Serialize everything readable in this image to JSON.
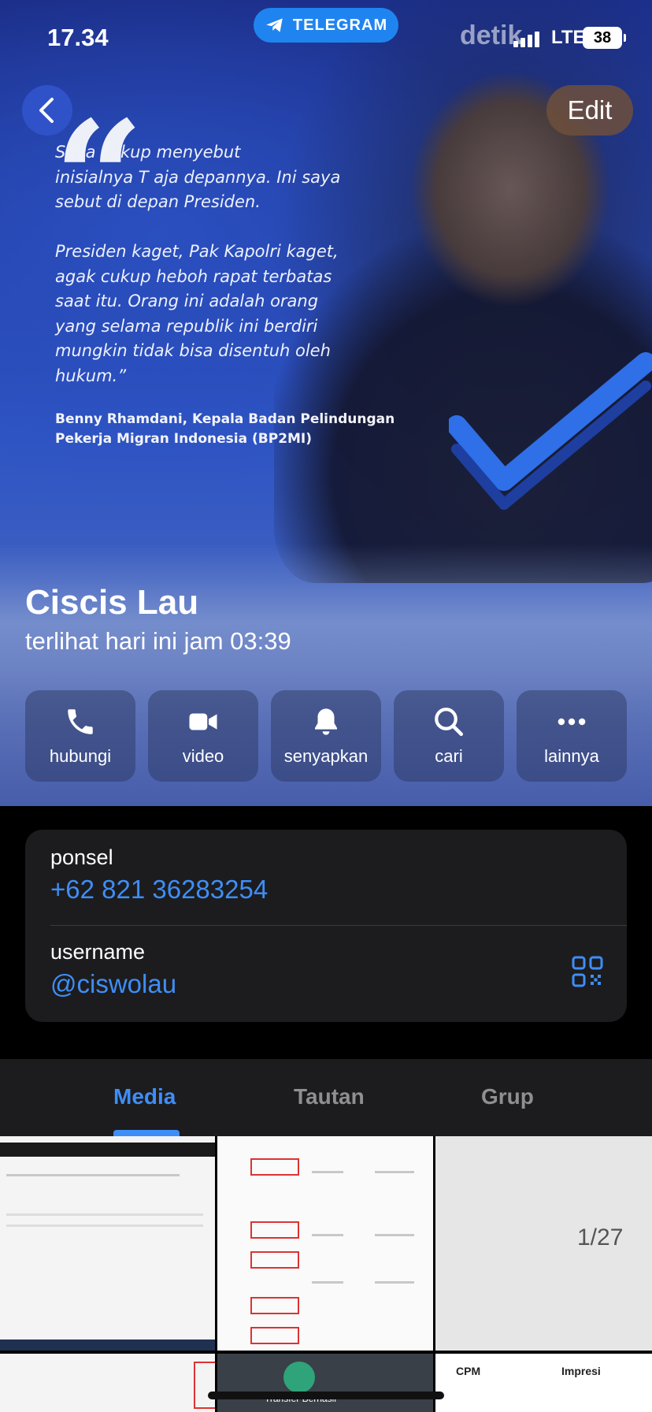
{
  "status_bar": {
    "time": "17.34",
    "watermark": "detik",
    "network": "LTE",
    "battery": "38"
  },
  "telegram_pill": {
    "label": "TELEGRAM"
  },
  "header": {
    "edit_label": "Edit"
  },
  "profile_photo": {
    "quote": "Saya cukup menyebut\ninisialnya T aja depannya. Ini saya\nsebut di depan Presiden.\n\nPresiden kaget, Pak Kapolri kaget,\nagak cukup heboh rapat terbatas\nsaat itu. Orang ini adalah orang\nyang selama republik ini berdiri\nmungkin tidak bisa disentuh oleh\nhukum.”",
    "author": "Benny Rhamdani, Kepala Badan Pelindungan Pekerja Migran Indonesia (BP2MI)"
  },
  "profile": {
    "name": "Ciscis Lau",
    "last_seen": "terlihat hari ini jam 03:39"
  },
  "actions": [
    {
      "label": "hubungi",
      "icon": "phone-icon"
    },
    {
      "label": "video",
      "icon": "video-icon"
    },
    {
      "label": "senyapkan",
      "icon": "bell-icon"
    },
    {
      "label": "cari",
      "icon": "search-icon"
    },
    {
      "label": "lainnya",
      "icon": "more-icon"
    }
  ],
  "info": {
    "phone_label": "ponsel",
    "phone_value": "+62 821 36283254",
    "username_label": "username",
    "username_value": "@ciswolau"
  },
  "tabs": [
    {
      "label": "Media",
      "active": true
    },
    {
      "label": "Tautan",
      "active": false
    },
    {
      "label": "Grup",
      "active": false
    }
  ],
  "media": {
    "page_indicator": "1/27",
    "thumb6_col1": "CPM",
    "thumb6_col2": "Impresi",
    "thumb5_text": "Transfer Berhasil"
  },
  "colors": {
    "accent": "#3e8ef7",
    "telegram_blue": "#1f84ef",
    "card_bg": "#1c1c1e"
  }
}
